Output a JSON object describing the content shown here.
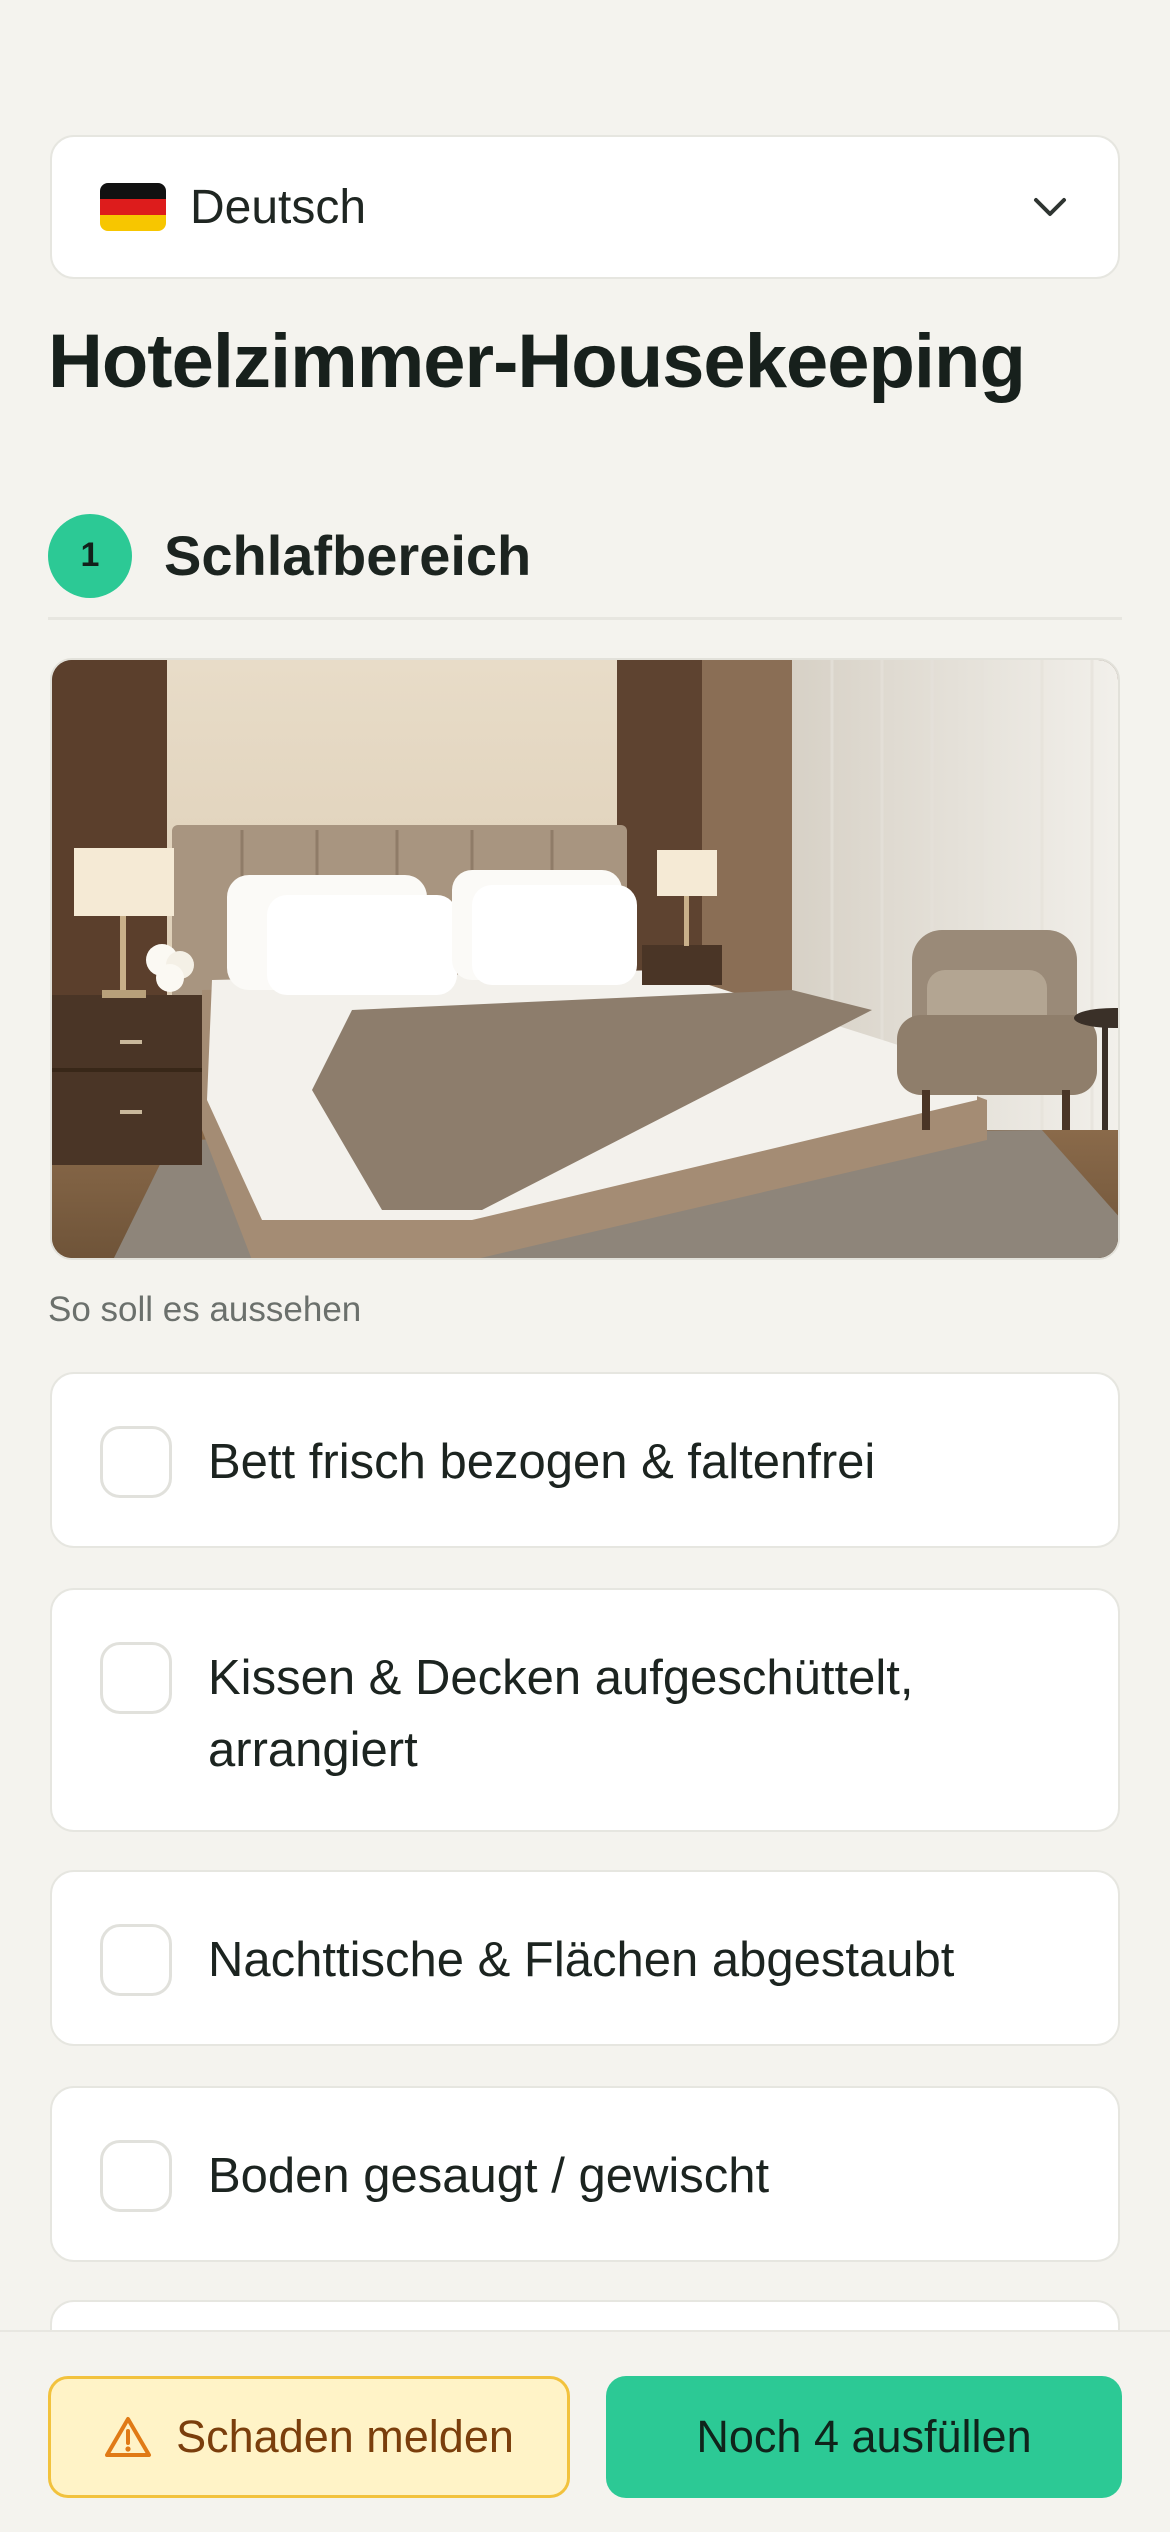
{
  "language": {
    "selected": "Deutsch",
    "flag": "germany-flag-icon"
  },
  "page": {
    "title": "Hotelzimmer-Housekeeping"
  },
  "section": {
    "number": "1",
    "title": "Schlafbereich"
  },
  "reference": {
    "caption": "So soll es aussehen"
  },
  "checklist": [
    {
      "label": "Bett frisch bezogen & faltenfrei",
      "checked": false
    },
    {
      "label": "Kissen & Decken aufgeschüttelt, arrangiert",
      "checked": false
    },
    {
      "label": "Nachttische & Flächen abgestaubt",
      "checked": false
    },
    {
      "label": "Boden gesaugt / gewischt",
      "checked": false
    }
  ],
  "actions": {
    "report_damage": "Schaden melden",
    "remaining": "Noch 4 ausfüllen"
  },
  "colors": {
    "accent": "#2cc995",
    "warning_bg": "#fff3c7",
    "warning_border": "#f2c23d",
    "warning_text": "#7a3e0c",
    "background": "#f4f3ee"
  }
}
